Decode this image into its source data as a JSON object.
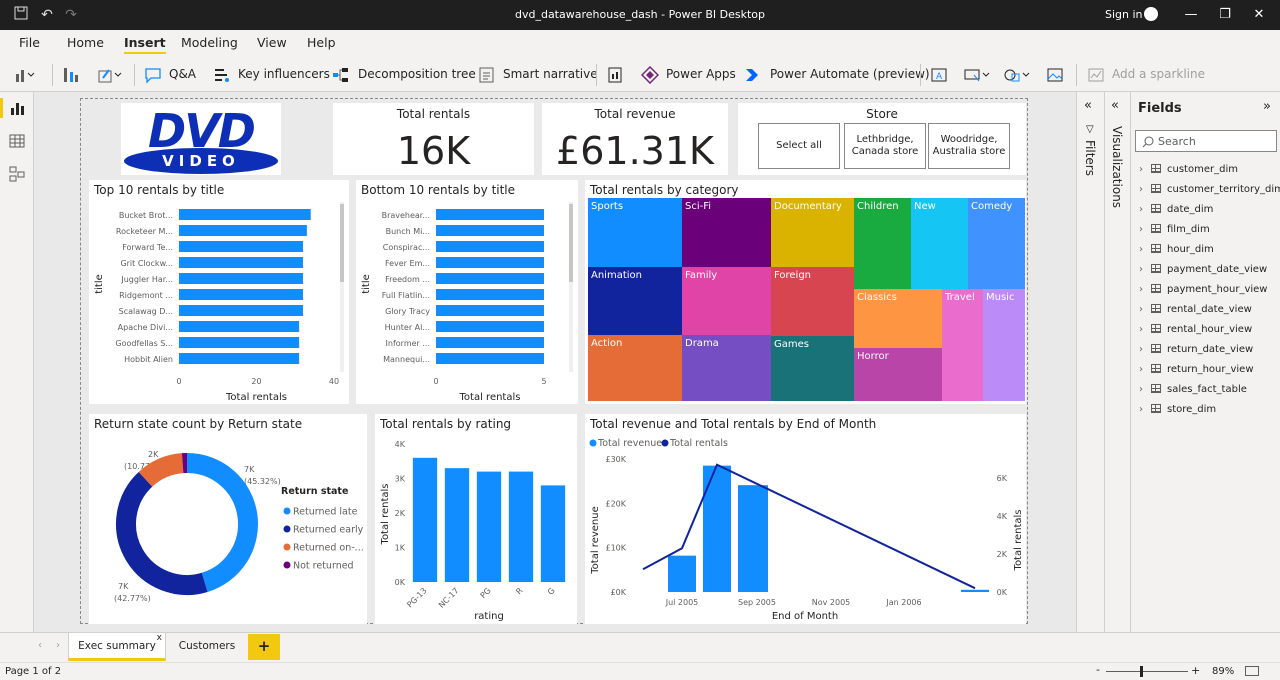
{
  "window": {
    "title": "dvd_datawarehouse_dash - Power BI Desktop",
    "sign_in": "Sign in"
  },
  "menu": [
    "File",
    "Home",
    "Insert",
    "Modeling",
    "View",
    "Help"
  ],
  "menu_active": "Insert",
  "ribbon": {
    "qa": "Q&A",
    "key_influencers": "Key influencers",
    "decomposition_tree": "Decomposition tree",
    "smart_narrative": "Smart narrative",
    "power_apps": "Power Apps",
    "power_automate": "Power Automate (preview)",
    "sparkline": "Add a sparkline"
  },
  "logo": {
    "line1": "DVD",
    "line2": "VIDEO"
  },
  "kpis": [
    {
      "label": "Total rentals",
      "value": "16K"
    },
    {
      "label": "Total revenue",
      "value": "£61.31K"
    }
  ],
  "slicer": {
    "title": "Store",
    "options": [
      "Select all",
      "Lethbridge, Canada store",
      "Woodridge, Australia store"
    ]
  },
  "top10": {
    "title": "Top 10 rentals by title",
    "chart_data": {
      "type": "bar",
      "categories": [
        "Bucket Brot...",
        "Rocketeer M...",
        "Forward Te...",
        "Grit Clockw...",
        "Juggler Har...",
        "Ridgemont ...",
        "Scalawag D...",
        "Apache Divi...",
        "Goodfellas S...",
        "Hobbit Alien"
      ],
      "values": [
        34,
        33,
        32,
        32,
        32,
        32,
        32,
        31,
        31,
        31
      ],
      "xlabel": "Total rentals",
      "ylabel": "title",
      "xlim": [
        0,
        40
      ],
      "ticks": [
        "0",
        "20",
        "40"
      ]
    }
  },
  "bottom10": {
    "title": "Bottom 10 rentals by title",
    "chart_data": {
      "type": "bar",
      "categories": [
        "Bravehear...",
        "Bunch Mi...",
        "Conspirac...",
        "Fever Em...",
        "Freedom ...",
        "Full Flatlin...",
        "Glory Tracy",
        "Hunter Al...",
        "Informer ...",
        "Mannequi..."
      ],
      "values": [
        5,
        5,
        5,
        5,
        5,
        5,
        5,
        5,
        5,
        5
      ],
      "xlabel": "Total rentals",
      "ylabel": "title",
      "xlim": [
        0,
        5
      ],
      "ticks": [
        "0",
        "5"
      ]
    }
  },
  "treemap": {
    "title": "Total rentals by category",
    "chart_data": {
      "type": "treemap",
      "categories": [
        "Sports",
        "Sci-Fi",
        "Documentary",
        "Children",
        "New",
        "Comedy",
        "Animation",
        "Family",
        "Foreign",
        "Classics",
        "Travel",
        "Music",
        "Action",
        "Drama",
        "Games",
        "Horror"
      ]
    }
  },
  "donut": {
    "title": "Return state count by Return state",
    "legend_title": "Return state",
    "labels": {
      "a": "7K",
      "a_pct": "(45.32%)",
      "b": "7K",
      "b_pct": "(42.77%)",
      "c": "2K",
      "c_pct": "(10.77%)"
    },
    "chart_data": {
      "type": "pie",
      "categories": [
        "Returned late",
        "Returned early",
        "Returned on-...",
        "Not returned"
      ],
      "values": [
        45.32,
        42.77,
        10.77,
        1.14
      ],
      "colors": [
        "#118dff",
        "#12239e",
        "#e66c37",
        "#6b007b"
      ]
    }
  },
  "rating": {
    "title": "Total rentals by rating",
    "chart_data": {
      "type": "bar",
      "categories": [
        "PG-13",
        "NC-17",
        "PG",
        "R",
        "G"
      ],
      "values": [
        3600,
        3300,
        3200,
        3200,
        2800
      ],
      "xlabel": "rating",
      "ylabel": "Total rentals",
      "ylim": [
        0,
        4000
      ],
      "ticks": [
        "0K",
        "1K",
        "2K",
        "3K",
        "4K"
      ]
    }
  },
  "combo": {
    "title": "Total revenue and Total rentals by End of Month",
    "legend": [
      "Total revenue",
      "Total rentals"
    ],
    "chart_data": {
      "type": "bar",
      "x": [
        "Jun 2005",
        "Jul 2005",
        "Aug 2005",
        "Feb 2006"
      ],
      "series": [
        {
          "name": "Total revenue",
          "values": [
            8200,
            28500,
            24100,
            500
          ]
        },
        {
          "name": "Total rentals",
          "values": [
            1200,
            2300,
            6700,
            200
          ]
        }
      ],
      "xlabel": "End of Month",
      "ylabel": "Total revenue",
      "y2label": "Total rentals",
      "ylim": [
        0,
        30000
      ],
      "y2lim": [
        0,
        7000
      ],
      "y_ticks": [
        "£0K",
        "£10K",
        "£20K",
        "£30K"
      ],
      "y2_ticks": [
        "0K",
        "2K",
        "4K",
        "6K"
      ],
      "x_ticks": [
        "Jul 2005",
        "Sep 2005",
        "Nov 2005",
        "Jan 2006"
      ]
    }
  },
  "filters_label": "Filters",
  "viz_label": "Visualizations",
  "fields": {
    "title": "Fields",
    "search_placeholder": "Search",
    "items": [
      "customer_dim",
      "customer_territory_dim",
      "date_dim",
      "film_dim",
      "hour_dim",
      "payment_date_view",
      "payment_hour_view",
      "rental_date_view",
      "rental_hour_view",
      "return_date_view",
      "return_hour_view",
      "sales_fact_table",
      "store_dim"
    ]
  },
  "tabs": {
    "exec": "Exec summary",
    "customers": "Customers",
    "add": "+"
  },
  "status": {
    "page": "Page 1 of 2",
    "zoom": "89%"
  }
}
